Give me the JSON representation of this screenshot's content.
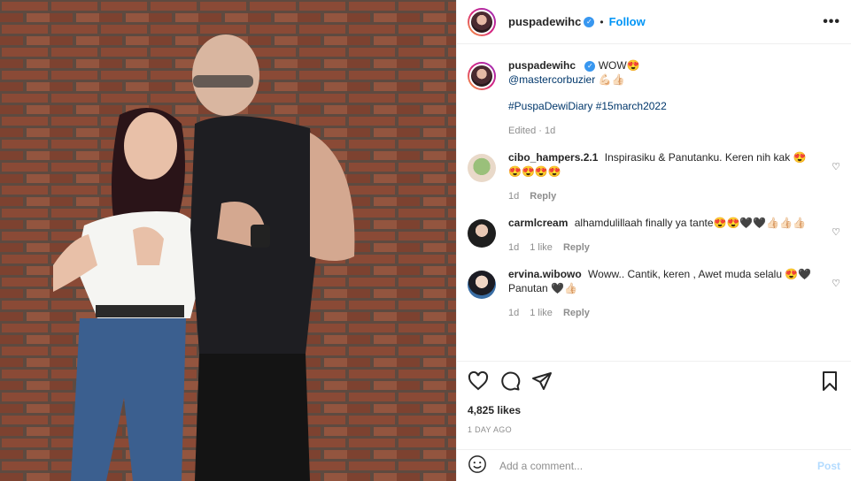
{
  "header": {
    "username": "puspadewihc",
    "separator": "•",
    "follow_label": "Follow",
    "more_label": "•••"
  },
  "caption": {
    "username": "puspadewihc",
    "text": "WOW😍",
    "mention": "@mastercorbuzier 💪🏻👍🏻",
    "hashtags": "#PuspaDewiDiary #15march2022",
    "meta": "Edited · 1d"
  },
  "comments": [
    {
      "username": "cibo_hampers.2.1",
      "text": "Inspirasiku & Panutanku. Keren nih kak 😍😍😍😍😍",
      "time": "1d",
      "likes": "",
      "reply": "Reply"
    },
    {
      "username": "carmlcream",
      "text": "alhamdulillaah finally ya tante😍😍🖤🖤👍🏻👍🏻👍🏻",
      "time": "1d",
      "likes": "1 like",
      "reply": "Reply"
    },
    {
      "username": "ervina.wibowo",
      "text": "Woww.. Cantik, keren , Awet muda selalu 😍🖤 Panutan 🖤👍🏻",
      "time": "1d",
      "likes": "1 like",
      "reply": "Reply"
    }
  ],
  "actions": {
    "likes": "4,825 likes",
    "posted_ago": "1 DAY AGO"
  },
  "composer": {
    "placeholder": "Add a comment...",
    "post_label": "Post"
  },
  "colors": {
    "accent": "#0095f6",
    "link": "#00376b",
    "muted": "#8e8e8e",
    "post_disabled": "#b3dbff"
  }
}
